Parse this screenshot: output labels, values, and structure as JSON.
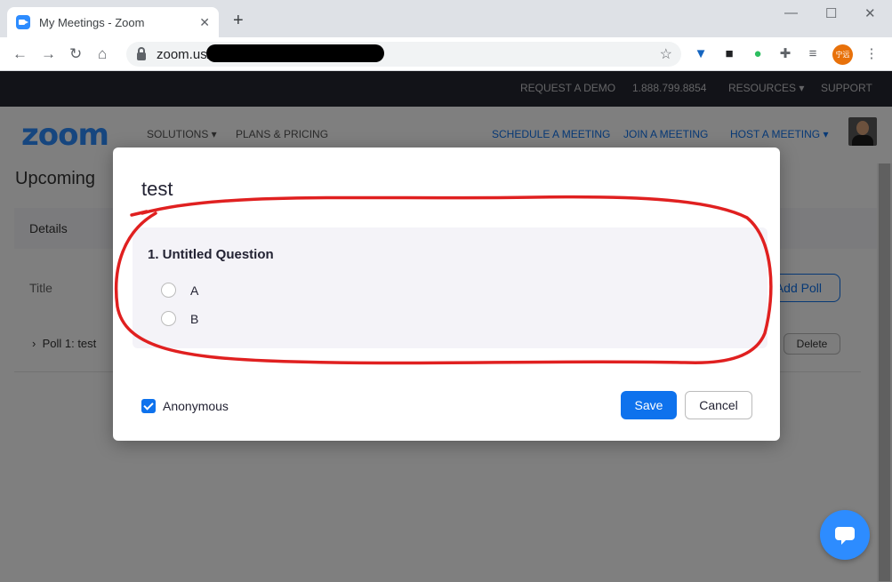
{
  "browser": {
    "tab_title": "My Meetings - Zoom",
    "tab_close": "✕",
    "new_tab": "+",
    "url": "zoom.us/",
    "profile_initials": "宁远"
  },
  "topnav": {
    "request_demo": "REQUEST A DEMO",
    "phone": "1.888.799.8854",
    "resources": "RESOURCES ▾",
    "support": "SUPPORT"
  },
  "mainnav": {
    "logo": "zoom",
    "solutions": "SOLUTIONS ▾",
    "plans": "PLANS & PRICING",
    "schedule": "SCHEDULE A MEETING",
    "join": "JOIN A MEETING",
    "host": "HOST A MEETING ▾"
  },
  "page": {
    "heading": "Upcoming",
    "details_tab": "Details",
    "title_label": "Title",
    "add_poll": "Add Poll",
    "poll_row": "Poll 1: test",
    "delete": "Delete"
  },
  "modal": {
    "title": "test",
    "question": "1. Untitled Question",
    "options": [
      "A",
      "B"
    ],
    "anonymous_label": "Anonymous",
    "save_label": "Save",
    "cancel_label": "Cancel"
  },
  "colors": {
    "accent": "#0e72ed",
    "annotation": "#e02020"
  }
}
